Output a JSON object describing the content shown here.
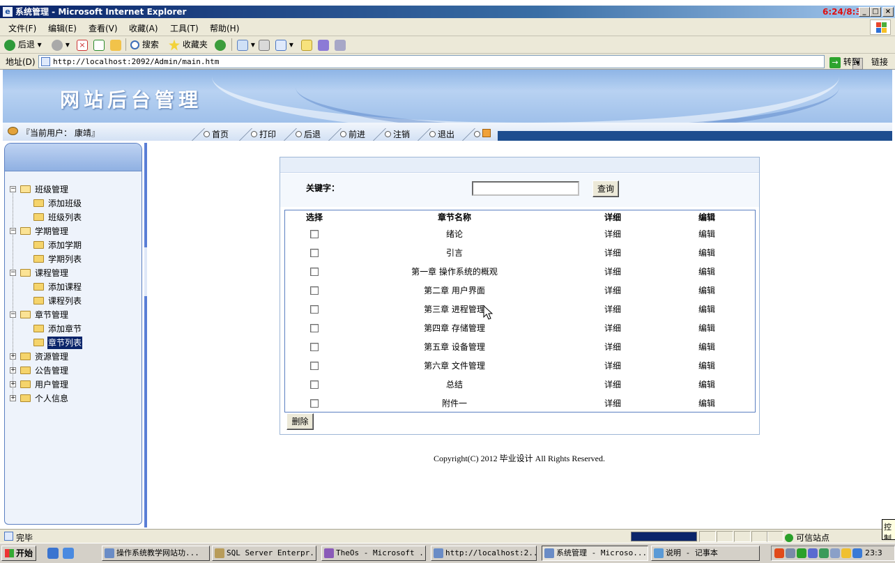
{
  "window": {
    "title": "系统管理 - Microsoft Internet Explorer",
    "clock_overlay": "6:24/8:32"
  },
  "menu": [
    "文件(F)",
    "编辑(E)",
    "查看(V)",
    "收藏(A)",
    "工具(T)",
    "帮助(H)"
  ],
  "toolbar": {
    "back": "后退",
    "search": "搜索",
    "favorites": "收藏夹"
  },
  "address": {
    "label": "地址(D)",
    "url": "http://localhost:2092/Admin/main.htm",
    "go": "转到",
    "links": "链接"
  },
  "banner": {
    "title": "网站后台管理"
  },
  "nav": {
    "user_info": "『当前用户： 康靖』",
    "links": [
      "首页",
      "打印",
      "后退",
      "前进",
      "注销",
      "退出"
    ]
  },
  "tree": [
    {
      "label": "班级管理",
      "expanded": true,
      "children": [
        "添加班级",
        "班级列表"
      ]
    },
    {
      "label": "学期管理",
      "expanded": true,
      "children": [
        "添加学期",
        "学期列表"
      ]
    },
    {
      "label": "课程管理",
      "expanded": true,
      "children": [
        "添加课程",
        "课程列表"
      ]
    },
    {
      "label": "章节管理",
      "expanded": true,
      "children": [
        "添加章节",
        "章节列表"
      ]
    },
    {
      "label": "资源管理",
      "expanded": false,
      "children": []
    },
    {
      "label": "公告管理",
      "expanded": false,
      "children": []
    },
    {
      "label": "用户管理",
      "expanded": false,
      "children": []
    },
    {
      "label": "个人信息",
      "expanded": false,
      "children": []
    }
  ],
  "tree_selected": "章节列表",
  "search": {
    "label": "关键字：",
    "value": "",
    "button": "查询"
  },
  "table": {
    "headers": [
      "选择",
      "章节名称",
      "详细",
      "编辑"
    ],
    "rows": [
      {
        "name": "绪论",
        "detail": "详细",
        "edit": "编辑"
      },
      {
        "name": "引言",
        "detail": "详细",
        "edit": "编辑"
      },
      {
        "name": "第一章 操作系统的概观",
        "detail": "详细",
        "edit": "编辑"
      },
      {
        "name": "第二章 用户界面",
        "detail": "详细",
        "edit": "编辑"
      },
      {
        "name": "第三章 进程管理",
        "detail": "详细",
        "edit": "编辑"
      },
      {
        "name": "第四章 存储管理",
        "detail": "详细",
        "edit": "编辑"
      },
      {
        "name": "第五章 设备管理",
        "detail": "详细",
        "edit": "编辑"
      },
      {
        "name": "第六章 文件管理",
        "detail": "详细",
        "edit": "编辑"
      },
      {
        "name": "总结",
        "detail": "详细",
        "edit": "编辑"
      },
      {
        "name": "附件一",
        "detail": "详细",
        "edit": "编辑"
      }
    ],
    "delete_button": "删除"
  },
  "footer": {
    "copyright": "Copyright(C) 2012 毕业设计  All Rights Reserved."
  },
  "statusbar": {
    "text": "完毕",
    "zone": "可信站点"
  },
  "taskbar": {
    "start": "开始",
    "tasks": [
      {
        "label": "操作系统教学网站功...",
        "active": false
      },
      {
        "label": "SQL Server Enterpr...",
        "active": false
      },
      {
        "label": "TheOs - Microsoft ...",
        "active": false
      },
      {
        "label": "http://localhost:2...",
        "active": false
      },
      {
        "label": "系统管理 - Microso...",
        "active": true
      },
      {
        "label": "说明 - 记事本",
        "active": false
      }
    ],
    "clock": "23:3",
    "tray_popup": "控制"
  },
  "colors": {
    "title_blue": "#0a246a",
    "banner_blue": "#9fc0ea",
    "nav_dark": "#1d4d8f",
    "selected_bg": "#0a246a",
    "clock_red": "#e01010"
  }
}
